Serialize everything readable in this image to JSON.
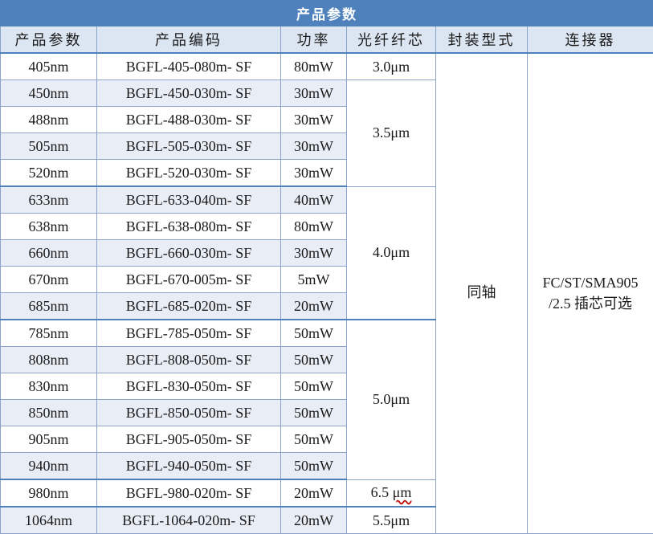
{
  "table": {
    "title": "产品参数",
    "headers": [
      "产品参数",
      "产品编码",
      "功率",
      "光纤纤芯",
      "封装型式",
      "连接器"
    ],
    "rows": [
      {
        "wavelength": "405nm",
        "code": "BGFL-405-080m- SF",
        "power": "80mW"
      },
      {
        "wavelength": "450nm",
        "code": "BGFL-450-030m- SF",
        "power": "30mW"
      },
      {
        "wavelength": "488nm",
        "code": "BGFL-488-030m- SF",
        "power": "30mW"
      },
      {
        "wavelength": "505nm",
        "code": "BGFL-505-030m- SF",
        "power": "30mW"
      },
      {
        "wavelength": "520nm",
        "code": "BGFL-520-030m- SF",
        "power": "30mW"
      },
      {
        "wavelength": "633nm",
        "code": "BGFL-633-040m- SF",
        "power": "40mW"
      },
      {
        "wavelength": "638nm",
        "code": "BGFL-638-080m- SF",
        "power": "80mW"
      },
      {
        "wavelength": "660nm",
        "code": "BGFL-660-030m- SF",
        "power": "30mW"
      },
      {
        "wavelength": "670nm",
        "code": "BGFL-670-005m- SF",
        "power": "5mW"
      },
      {
        "wavelength": "685nm",
        "code": "BGFL-685-020m- SF",
        "power": "20mW"
      },
      {
        "wavelength": "785nm",
        "code": "BGFL-785-050m- SF",
        "power": "50mW"
      },
      {
        "wavelength": "808nm",
        "code": "BGFL-808-050m- SF",
        "power": "50mW"
      },
      {
        "wavelength": "830nm",
        "code": "BGFL-830-050m- SF",
        "power": "50mW"
      },
      {
        "wavelength": "850nm",
        "code": "BGFL-850-050m- SF",
        "power": "50mW"
      },
      {
        "wavelength": "905nm",
        "code": "BGFL-905-050m- SF",
        "power": "50mW"
      },
      {
        "wavelength": "940nm",
        "code": "BGFL-940-050m- SF",
        "power": "50mW"
      },
      {
        "wavelength": "980nm",
        "code": "BGFL-980-020m- SF",
        "power": "20mW"
      },
      {
        "wavelength": "1064nm",
        "code": "BGFL-1064-020m- SF",
        "power": "20mW"
      }
    ],
    "core_groups": [
      {
        "value": "3.0μm"
      },
      {
        "value": "3.5μm"
      },
      {
        "value": "4.0μm"
      },
      {
        "value": "5.0μm"
      },
      {
        "value_num": "6.5",
        "value_unit": "μm"
      },
      {
        "value": "5.5μm"
      }
    ],
    "package": "同轴",
    "connector_line1": "FC/ST/SMA905",
    "connector_line2_num": "/2.5",
    "connector_line2_text": "插芯可选"
  }
}
